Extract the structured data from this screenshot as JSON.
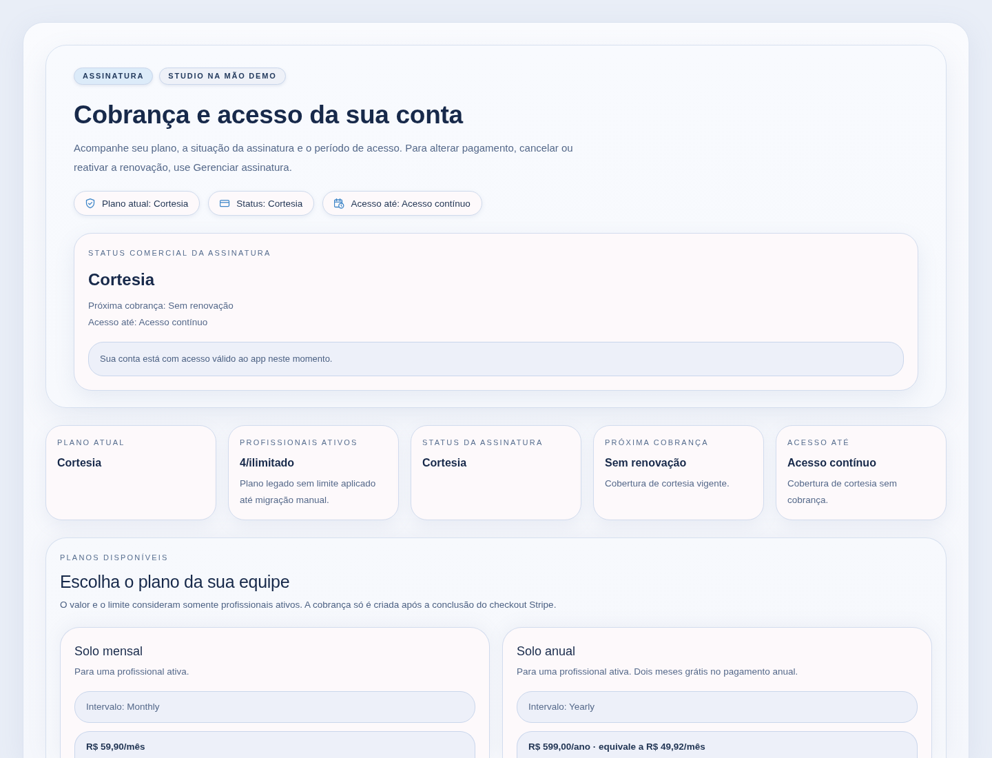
{
  "tags": [
    {
      "label": "ASSINATURA",
      "kind": "accent"
    },
    {
      "label": "STUDIO NA MÃO DEMO",
      "kind": "plain"
    }
  ],
  "title": "Cobrança e acesso da sua conta",
  "description": "Acompanhe seu plano, a situação da assinatura e o período de acesso. Para alterar pagamento, cancelar ou reativar a renovação, use Gerenciar assinatura.",
  "chips": [
    {
      "kind": "plan",
      "label": "Plano atual: Cortesia"
    },
    {
      "kind": "status",
      "label": "Status: Cortesia"
    },
    {
      "kind": "access",
      "label": "Acesso até: Acesso contínuo"
    }
  ],
  "status_card": {
    "label": "STATUS COMERCIAL DA ASSINATURA",
    "title": "Cortesia",
    "lines": [
      "Próxima cobrança: Sem renovação",
      "Acesso até: Acesso contínuo"
    ],
    "notice": "Sua conta está com acesso válido ao app neste momento."
  },
  "summary_cards": [
    {
      "label": "PLANO ATUAL",
      "value": "Cortesia"
    },
    {
      "label": "PROFISSIONAIS ATIVOS",
      "value": "4/ilimitado",
      "note": "Plano legado sem limite aplicado até migração manual."
    },
    {
      "label": "STATUS DA ASSINATURA",
      "value": "Cortesia"
    },
    {
      "label": "PRÓXIMA COBRANÇA",
      "value": "Sem renovação",
      "note": "Cobertura de cortesia vigente."
    },
    {
      "label": "ACESSO ATÉ",
      "value": "Acesso contínuo",
      "note": "Cobertura de cortesia sem cobrança."
    }
  ],
  "plans_section": {
    "label": "PLANOS DISPONÍVEIS",
    "title": "Escolha o plano da sua equipe",
    "description": "O valor e o limite consideram somente profissionais ativos. A cobrança só é criada após a conclusão do checkout Stripe.",
    "plans": [
      {
        "name": "Solo mensal",
        "description": "Para uma profissional ativa.",
        "interval": "Intervalo: Monthly",
        "price": "R$ 59,90/mês"
      },
      {
        "name": "Solo anual",
        "description": "Para uma profissional ativa. Dois meses grátis no pagamento anual.",
        "interval": "Intervalo: Yearly",
        "price": "R$ 599,00/ano · equivale a R$ 49,92/mês"
      }
    ]
  }
}
